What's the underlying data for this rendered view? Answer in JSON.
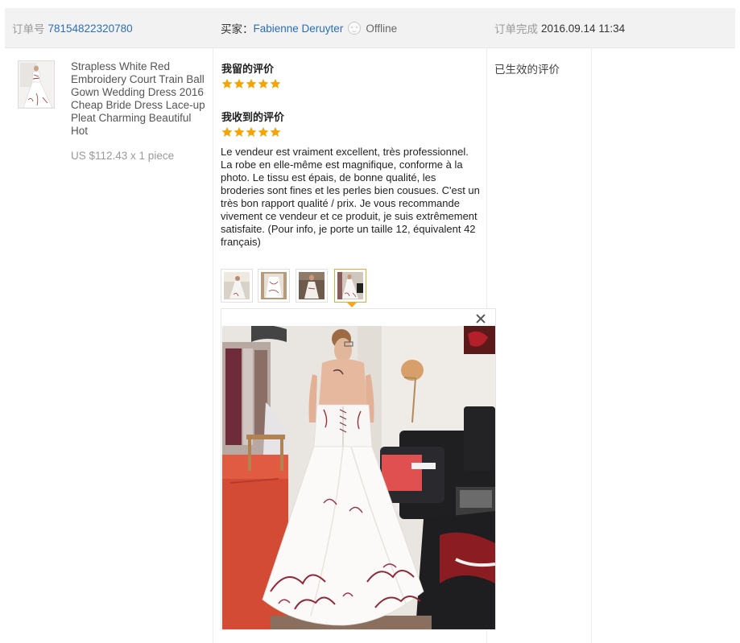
{
  "order": {
    "number_label": "订单号",
    "number": "78154822320780",
    "buyer_label": "买家：",
    "buyer_name": "Fabienne Deruyter",
    "buyer_status": "Offline",
    "completed_label": "订单完成",
    "completed_time": "2016.09.14 11:34"
  },
  "product": {
    "title": "Strapless White Red Embroidery Court Train Ball Gown Wedding Dress 2016 Cheap Bride Dress Lace-up Pleat Charming Beautiful Hot",
    "price": "US $112.43 x 1 piece"
  },
  "feedback": {
    "left_heading": "我留的评价",
    "left_stars": 5,
    "received_heading": "我收到的评价",
    "received_stars": 5,
    "review_text": "Le vendeur est vraiment excellent, très professionnel. La robe en elle-même est magnifique, conforme à la photo. Le tissu est épais, de bonne qualité, les broderies sont fines et les perles bien cousues. C'est un très bon rapport qualité / prix. Je vous recommande vivement ce vendeur et ce produit, je suis extrêmement satisfaite. (Pour info, je porte un taille 12, équivalent 42 français)",
    "photo_count": 4,
    "active_photo": 4
  },
  "status": {
    "text": "已生效的评价"
  },
  "colors": {
    "link": "#2a6ebb",
    "star": "#f7a300",
    "active_border": "#f5a623",
    "header_bg": "#f2f2f2"
  },
  "icons": [
    "offline-face-icon",
    "star-icon",
    "close-icon"
  ]
}
